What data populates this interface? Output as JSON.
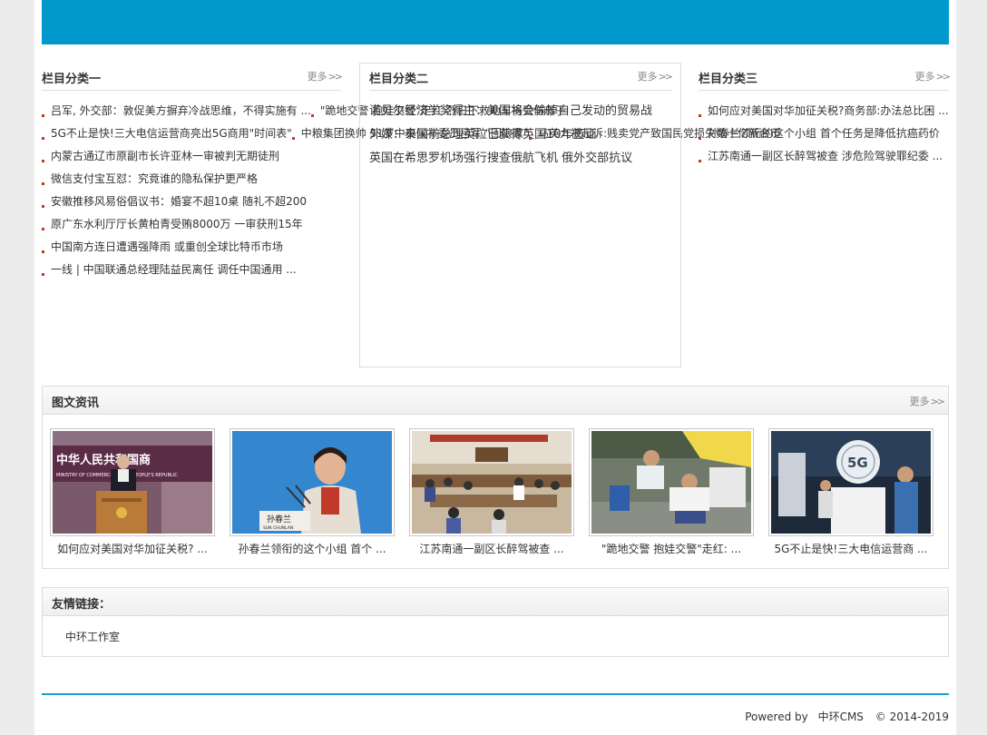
{
  "colors": {
    "banner": "#0099cc",
    "accent": "#1a9bd2",
    "bullet": "#c0392b"
  },
  "more_label": "更多",
  "category1": {
    "title": "栏目分类一",
    "items": [
      "吕军, 外交部：敦促美方摒弃冷战思维，不得实施有 ...",
      "\"跪地交警 抱娃交警\"走红:烈日下救助车祸受伤母子",
      "5G不止是快!三大电信运营商亮出5G商用\"时间表\"",
      "中粮集团换帅 51岁中央候补委员吕军 “回娘家”",
      "马英九被起诉:贱卖党产致国民党损失数十亿新台币",
      "内蒙古通辽市原副市长许亚林一审被判无期徒刑",
      "微信支付宝互怼：究竟谁的隐私保护更严格",
      "安徽推移风易俗倡议书：婚宴不超10桌 随礼不超200",
      "原广东水利厅厅长黄柏青受贿8000万 一审获刑15年",
      "中国南方连日遭遇强降雨 或重创全球比特币市场",
      "一线 | 中国联通总经理陆益民离任 调任中国通用 ..."
    ]
  },
  "category2": {
    "title": "栏目分类二",
    "items": [
      "诺贝尔经济学奖得主：美国将会输掉自己发动的贸易战",
      "外媒：泰国前总理英拉已获得英国10年签证",
      "英国在希思罗机场强行搜查俄航飞机 俄外交部抗议"
    ]
  },
  "category3": {
    "title": "栏目分类三",
    "items": [
      "如何应对美国对华加征关税?商务部:办法总比困 ...",
      "孙春兰领衔的这个小组 首个任务是降低抗癌药价",
      "江苏南通一副区长醉驾被查 涉危险驾驶罪纪委 ..."
    ]
  },
  "news_pics": {
    "title": "图文资讯",
    "cards": [
      {
        "caption": "如何应对美国对华加征关税? ...",
        "image": "press-conference-podium-photo",
        "sign_text": "中华人民共和国商",
        "sign_sub": "MINISTRY OF COMMERCE OF THE PEOPLE'S REPUBLIC"
      },
      {
        "caption": "孙春兰领衔的这个小组 首个 ...",
        "image": "speaker-at-microphone-photo",
        "nameplate": "孙春兰",
        "nameplate_sub": "SUN CHUNLAN"
      },
      {
        "caption": "江苏南通一副区长醉驾被查 ...",
        "image": "meeting-room-photo"
      },
      {
        "caption": "\"跪地交警 抱娃交警\"走红: ...",
        "image": "roadside-rescue-photo"
      },
      {
        "caption": "5G不止是快!三大电信运营商 ...",
        "image": "5g-exhibition-photo",
        "sign_text": "5G"
      }
    ]
  },
  "friend_links": {
    "title": "友情链接：",
    "items": [
      "中环工作室"
    ]
  },
  "footer": {
    "powered": "Powered by",
    "cms": "中环CMS",
    "copyright": "© 2014-2019"
  }
}
